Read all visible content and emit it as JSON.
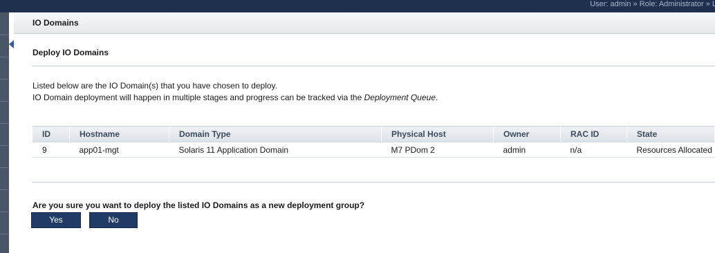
{
  "header": {
    "user_info": "User: admin » Role: Administrator » L"
  },
  "panel": {
    "title": "IO Domains"
  },
  "section": {
    "title": "Deploy IO Domains",
    "description_line1": "Listed below are the IO Domain(s) that you have chosen to deploy.",
    "description_line2_prefix": "IO Domain deployment will happen in multiple stages and progress can be tracked via the ",
    "description_line2_link": "Deployment Queue",
    "description_line2_suffix": "."
  },
  "table": {
    "columns": [
      "ID",
      "Hostname",
      "Domain Type",
      "Physical Host",
      "Owner",
      "RAC ID",
      "State"
    ],
    "rows": [
      {
        "id": "9",
        "hostname": "app01-mgt",
        "domain_type": "Solaris 11 Application Domain",
        "physical_host": "M7 PDom 2",
        "owner": "admin",
        "rac_id": "n/a",
        "state": "Resources Allocated"
      }
    ]
  },
  "confirm": {
    "question": "Are you sure you want to deploy the listed IO Domains as a new deployment group?",
    "yes_label": "Yes",
    "no_label": "No"
  },
  "colors": {
    "topbar": "#1f2f4e",
    "button": "#1f3b66",
    "sidebar": "#4b5568"
  }
}
